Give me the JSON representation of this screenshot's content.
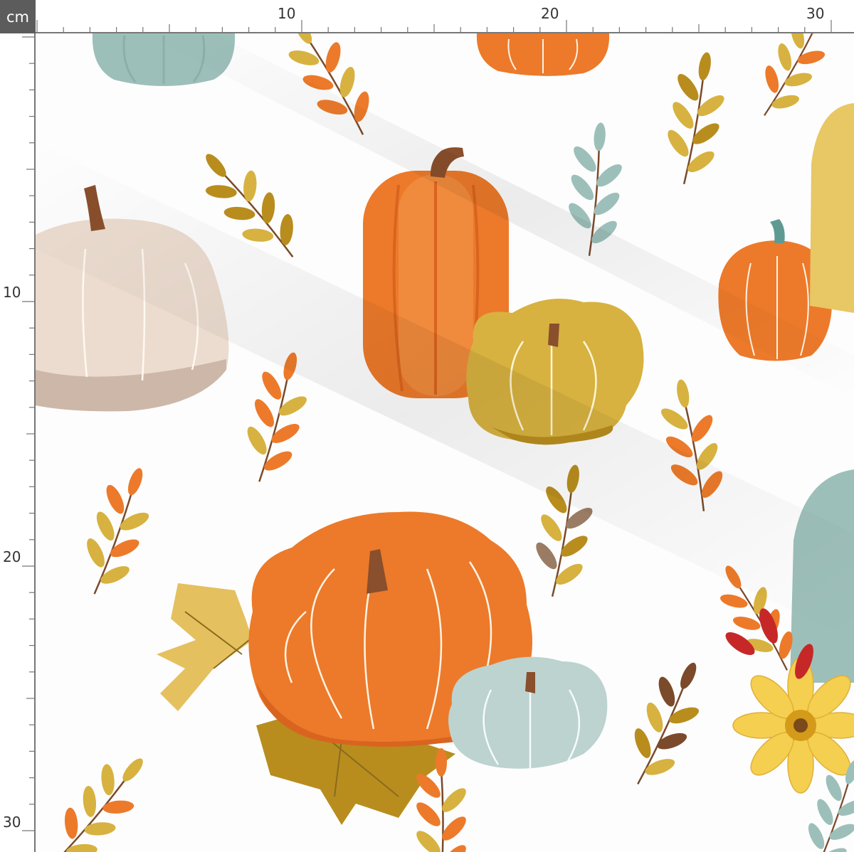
{
  "ruler": {
    "unit": "cm",
    "top_labels": [
      "10",
      "20",
      "30"
    ],
    "left_labels": [
      "10",
      "20",
      "30"
    ]
  },
  "pattern": {
    "theme": "autumn pumpkins and leaves",
    "background_color": "#fdfdfd",
    "colors": {
      "orange": "#ec7a2a",
      "orange_dark": "#d9641f",
      "mustard": "#d7b240",
      "mustard_dark": "#b88d1e",
      "sage": "#9dbfba",
      "sage_light": "#bcd3d0",
      "cream": "#ecdcd0",
      "cream_dark": "#cdb7a8",
      "stem": "#8a4f2c",
      "red": "#c62828",
      "flower_yellow": "#f5cf4f"
    }
  }
}
